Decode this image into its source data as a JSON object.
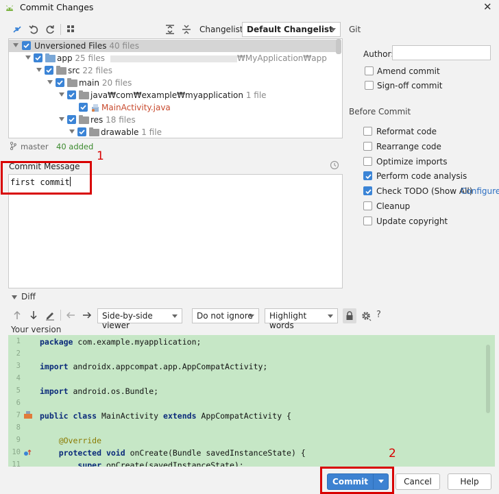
{
  "window": {
    "title": "Commit Changes",
    "close_glyph": "✕"
  },
  "toolbar": {
    "icons": [
      "show-diff-icon",
      "rollback-icon",
      "refresh-icon",
      "group-by-icon",
      "expand-all-icon",
      "collapse-all-icon"
    ],
    "changelist_label": "Changelist:",
    "changelist_value": "Default Changelist"
  },
  "tree": {
    "rows": [
      {
        "label": "Unversioned Files",
        "count": "40 files"
      },
      {
        "label": "app",
        "count": "25 files",
        "path": "₩MyApplication₩app"
      },
      {
        "label": "src",
        "count": "22 files"
      },
      {
        "label": "main",
        "count": "20 files"
      },
      {
        "label": "java₩com₩example₩myapplication",
        "count": "1 file"
      },
      {
        "label": "MainActivity.java"
      },
      {
        "label": "res",
        "count": "18 files"
      },
      {
        "label": "drawable",
        "count": "1 file"
      }
    ]
  },
  "status": {
    "branch": "master",
    "added": "40 added"
  },
  "annotations": {
    "marker_1": "1",
    "marker_2": "2"
  },
  "commit_message": {
    "label": "Commit Message",
    "value": "first commit"
  },
  "git": {
    "header": "Git",
    "author_label": "Author:",
    "author_value": "",
    "amend_commit": "Amend commit",
    "sign_off_commit": "Sign-off commit"
  },
  "before_commit": {
    "header": "Before Commit",
    "options": [
      {
        "label": "Reformat code",
        "checked": false
      },
      {
        "label": "Rearrange code",
        "checked": false
      },
      {
        "label": "Optimize imports",
        "checked": false
      },
      {
        "label": "Perform code analysis",
        "checked": true
      },
      {
        "label": "Check TODO (Show All)",
        "checked": true,
        "link": "Configure"
      },
      {
        "label": "Cleanup",
        "checked": false
      },
      {
        "label": "Update copyright",
        "checked": false
      }
    ]
  },
  "diff": {
    "header": "Diff",
    "viewer": "Side-by-side viewer",
    "ignore": "Do not ignore",
    "highlight": "Highlight words",
    "help_glyph": "?",
    "your_version": "Your version",
    "lines": [
      {
        "n": "1",
        "text": "package com.example.myapplication;"
      },
      {
        "n": "2",
        "text": ""
      },
      {
        "n": "3",
        "text": "import androidx.appcompat.app.AppCompatActivity;"
      },
      {
        "n": "4",
        "text": ""
      },
      {
        "n": "5",
        "text": "import android.os.Bundle;"
      },
      {
        "n": "6",
        "text": ""
      },
      {
        "n": "7",
        "text": "public class MainActivity extends AppCompatActivity {"
      },
      {
        "n": "8",
        "text": ""
      },
      {
        "n": "9",
        "text": "    @Override"
      },
      {
        "n": "10",
        "text": "    protected void onCreate(Bundle savedInstanceState) {"
      },
      {
        "n": "11",
        "text": "        super.onCreate(savedInstanceState);"
      }
    ]
  },
  "buttons": {
    "commit": "Commit",
    "cancel": "Cancel",
    "help": "Help"
  },
  "colors": {
    "accent": "#3d82d1",
    "diff_added_bg": "#c6e7c6",
    "annotation_red": "#d80000"
  }
}
